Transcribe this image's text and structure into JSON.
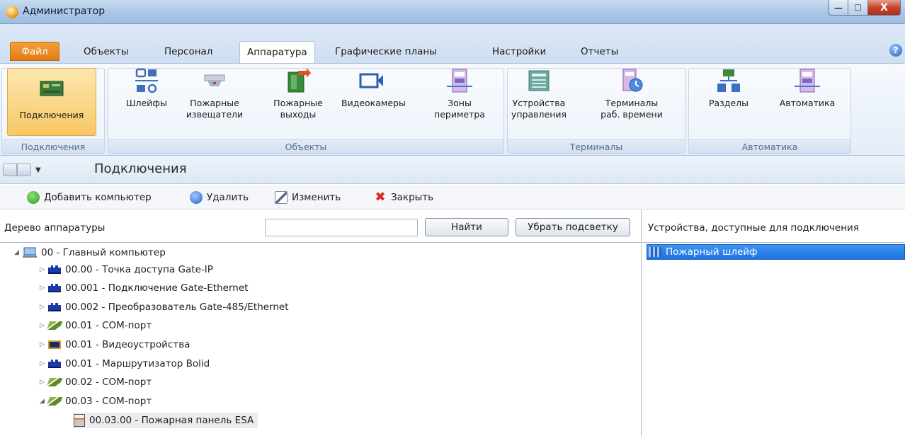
{
  "window": {
    "title": "Администратор",
    "buttons": {
      "minimize": "—",
      "maximize": "☐",
      "close": "X"
    }
  },
  "menu": {
    "tabs": [
      "Файл",
      "Объекты",
      "Персонал",
      "Аппаратура",
      "Графические планы",
      "Настройки",
      "Отчеты"
    ],
    "active": "Аппаратура"
  },
  "ribbon": {
    "groups": [
      {
        "label": "Подключения",
        "buttons": [
          "Подключения"
        ]
      },
      {
        "label": "Объекты",
        "buttons": [
          "Шлейфы",
          "Пожарные извещатели",
          "Пожарные выходы",
          "Видеокамеры",
          "Зоны периметра"
        ]
      },
      {
        "label": "Терминалы",
        "buttons": [
          "Устройства управления",
          "Терминалы раб. времени"
        ]
      },
      {
        "label": "Автоматика",
        "buttons": [
          "Разделы",
          "Автоматика"
        ]
      }
    ],
    "active_button": "Подключения"
  },
  "nav": {
    "title": "Подключения",
    "dropdown": "▼"
  },
  "toolbar": {
    "add": "Добавить компьютер",
    "delete": "Удалить",
    "edit": "Изменить",
    "close": "Закрыть"
  },
  "left_pane": {
    "header": "Дерево аппаратуры",
    "search_value": "",
    "find_button": "Найти",
    "clear_button": "Убрать подсветку",
    "tree": [
      {
        "label": "00 - Главный компьютер",
        "level": 0,
        "expanded": true,
        "icon": "computer-icon"
      },
      {
        "label": "00.00 - Точка доступа Gate-IP",
        "level": 1,
        "expanded": false,
        "icon": "board-icon"
      },
      {
        "label": "00.001 - Подключение Gate-Ethernet",
        "level": 1,
        "expanded": false,
        "icon": "board-icon"
      },
      {
        "label": "00.002 - Преобразователь Gate-485/Ethernet",
        "level": 1,
        "expanded": false,
        "icon": "board-icon"
      },
      {
        "label": "00.01 - COM-порт",
        "level": 1,
        "expanded": false,
        "icon": "cable-icon"
      },
      {
        "label": "00.01 - Видеоустройства",
        "level": 1,
        "expanded": false,
        "icon": "video-icon"
      },
      {
        "label": "00.01 - Маршрутизатор Bolid",
        "level": 1,
        "expanded": false,
        "icon": "board-icon"
      },
      {
        "label": "00.02 - COM-порт",
        "level": 1,
        "expanded": false,
        "icon": "cable-icon"
      },
      {
        "label": "00.03 - COM-порт",
        "level": 1,
        "expanded": true,
        "icon": "cable-icon"
      },
      {
        "label": "00.03.00 - Пожарная панель ESA",
        "level": 2,
        "expanded": null,
        "icon": "panel-icon"
      }
    ]
  },
  "right_pane": {
    "header": "Устройства, доступные для подключения",
    "items": [
      "Пожарный шлейф"
    ]
  }
}
